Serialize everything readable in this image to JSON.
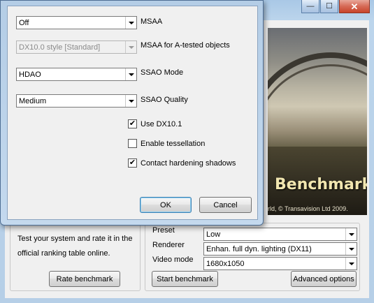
{
  "main_window": {
    "caption_buttons": {
      "minimize": "—",
      "maximize": "☐",
      "close": "✕"
    },
    "banner": {
      "title": "Benchmark",
      "copyright": "rld, © Transavision Ltd 2009."
    },
    "left_group": {
      "description": "Test your system and rate it in the official ranking table online.",
      "rate_button": "Rate benchmark"
    },
    "right_group": {
      "preset_label": "Preset",
      "preset_value": "Low",
      "renderer_label": "Renderer",
      "renderer_value": "Enhan. full dyn. lighting (DX11)",
      "video_mode_label": "Video mode",
      "video_mode_value": "1680x1050",
      "start_button": "Start benchmark",
      "advanced_button": "Advanced options"
    }
  },
  "dialog": {
    "msaa": {
      "label": "MSAA",
      "value": "Off"
    },
    "msaa_atest": {
      "label": "MSAA for A-tested objects",
      "value": "DX10.0 style [Standard]"
    },
    "ssao_mode": {
      "label": "SSAO Mode",
      "value": "HDAO"
    },
    "ssao_quality": {
      "label": "SSAO Quality",
      "value": "Medium"
    },
    "checkboxes": {
      "use_dx101": {
        "label": "Use DX10.1",
        "checked": true
      },
      "tessellation": {
        "label": "Enable tessellation",
        "checked": false
      },
      "contact_shadows": {
        "label": "Contact hardening shadows",
        "checked": true
      }
    },
    "ok_label": "OK",
    "cancel_label": "Cancel",
    "check_glyph": "✔"
  }
}
